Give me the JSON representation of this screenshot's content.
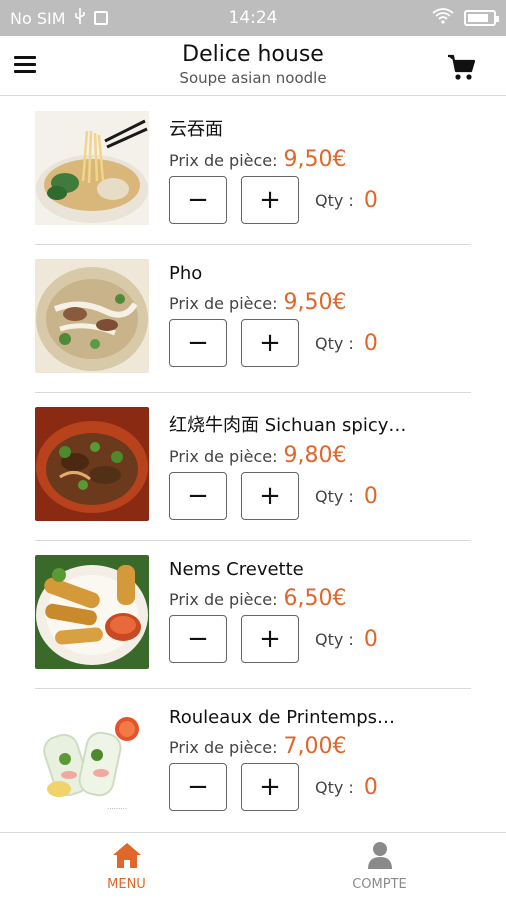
{
  "status_bar": {
    "carrier": "No SIM",
    "time": "14:24",
    "battery_level": 0.85
  },
  "header": {
    "title": "Delice house",
    "subtitle": "Soupe asian noodle",
    "menu_icon": "hamburger-icon",
    "cart_icon": "cart-icon"
  },
  "price_label": "Prix de pièce:",
  "qty_label": "Qty :",
  "minus_label": "−",
  "plus_label": "+",
  "items": [
    {
      "name": "云吞面",
      "price": "9,50€",
      "qty": "0"
    },
    {
      "name": "Pho",
      "price": "9,50€",
      "qty": "0"
    },
    {
      "name": "红烧牛肉面 Sichuan spicy…",
      "price": "9,80€",
      "qty": "0"
    },
    {
      "name": "Nems Crevette",
      "price": "6,50€",
      "qty": "0"
    },
    {
      "name": "Rouleaux de Printemps…",
      "price": "7,00€",
      "qty": "0"
    }
  ],
  "bottom_nav": {
    "menu_label": "MENU",
    "account_label": "COMPTE",
    "active_color": "#e0662a",
    "inactive_color": "#8a8a8a"
  }
}
